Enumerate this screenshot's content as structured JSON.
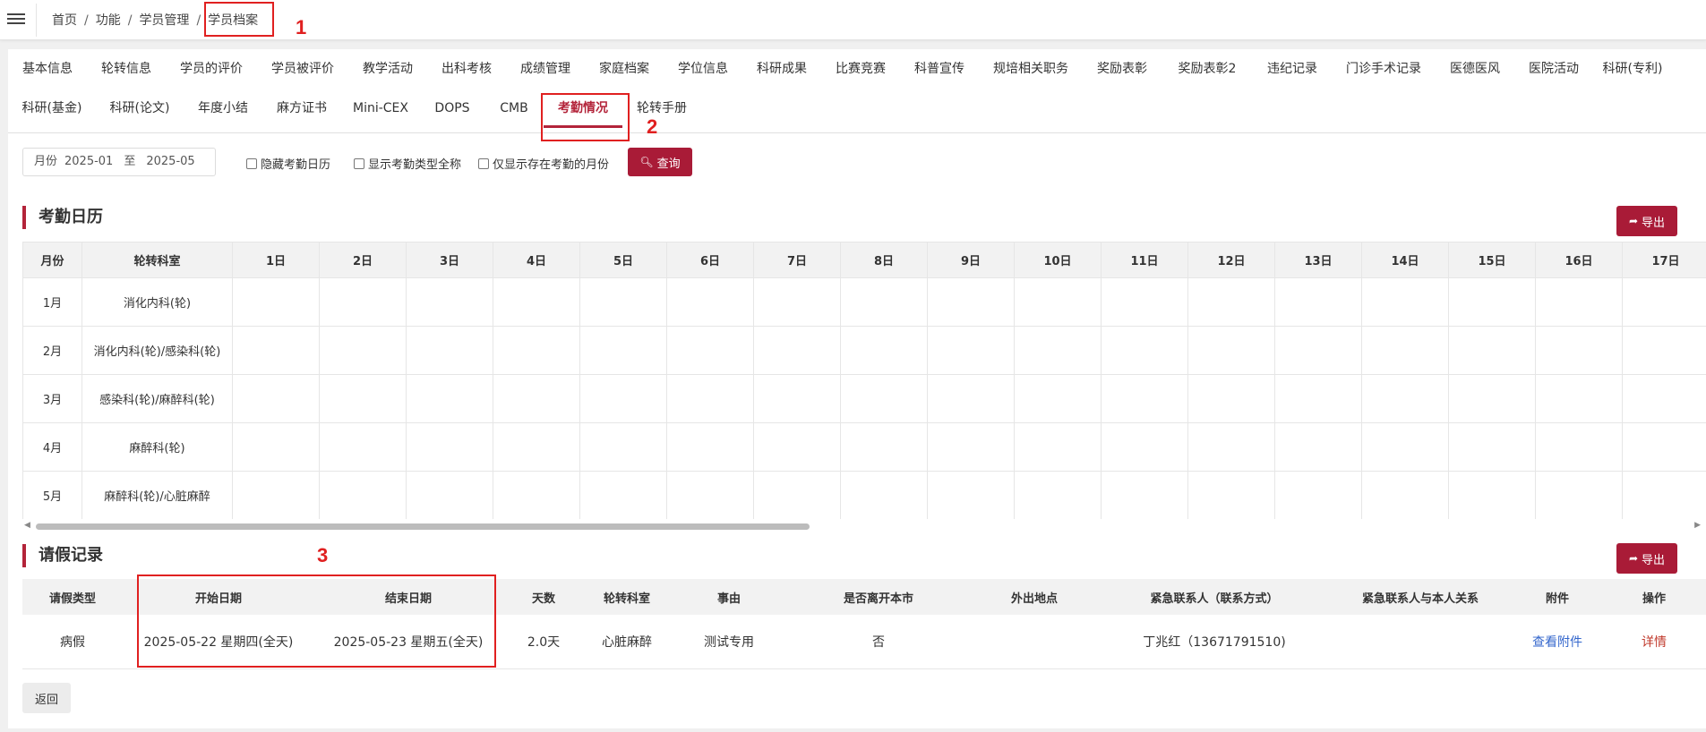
{
  "breadcrumb": {
    "items": [
      "首页",
      "功能",
      "学员管理",
      "学员档案"
    ],
    "separator": "/"
  },
  "tabs": {
    "row1": [
      "基本信息",
      "轮转信息",
      "学员的评价",
      "学员被评价",
      "教学活动",
      "出科考核",
      "成绩管理",
      "家庭档案",
      "学位信息",
      "科研成果",
      "比赛竞赛",
      "科普宣传",
      "规培相关职务",
      "奖励表彰",
      "奖励表彰2",
      "违纪记录",
      "门诊手术记录",
      "医德医风",
      "医院活动",
      "科研(专利)"
    ],
    "row2": [
      "科研(基金)",
      "科研(论文)",
      "年度小结",
      "麻方证书",
      "Mini-CEX",
      "DOPS",
      "CMB",
      "考勤情况",
      "轮转手册"
    ],
    "active": "考勤情况"
  },
  "annotations": [
    "1",
    "2",
    "3"
  ],
  "filter": {
    "month_label": "月份",
    "start_month": "2025-01",
    "to_label": "至",
    "end_month": "2025-05",
    "checkbox_hide_calendar": "隐藏考勤日历",
    "checkbox_show_fullname": "显示考勤类型全称",
    "checkbox_only_attendance": "仅显示存在考勤的月份",
    "query_button": "查询"
  },
  "attendance": {
    "title": "考勤日历",
    "export_button": "导出",
    "headers": [
      "月份",
      "轮转科室",
      "1日",
      "2日",
      "3日",
      "4日",
      "5日",
      "6日",
      "7日",
      "8日",
      "9日",
      "10日",
      "11日",
      "12日",
      "13日",
      "14日",
      "15日",
      "16日",
      "17日"
    ],
    "rows": [
      {
        "month": "1月",
        "dept": "消化内科(轮)"
      },
      {
        "month": "2月",
        "dept": "消化内科(轮)/感染科(轮)"
      },
      {
        "month": "3月",
        "dept": "感染科(轮)/麻醉科(轮)"
      },
      {
        "month": "4月",
        "dept": "麻醉科(轮)"
      },
      {
        "month": "5月",
        "dept": "麻醉科(轮)/心脏麻醉"
      }
    ]
  },
  "leave": {
    "title": "请假记录",
    "export_button": "导出",
    "headers": [
      "请假类型",
      "开始日期",
      "结束日期",
      "天数",
      "轮转科室",
      "事由",
      "是否离开本市",
      "外出地点",
      "紧急联系人（联系方式）",
      "紧急联系人与本人关系",
      "附件",
      "操作"
    ],
    "rows": [
      {
        "type": "病假",
        "start": "2025-05-22 星期四(全天)",
        "end": "2025-05-23 星期五(全天)",
        "days": "2.0天",
        "dept": "心脏麻醉",
        "reason": "测试专用",
        "leave_city": "否",
        "location": "",
        "contact": "丁兆红（13671791510)",
        "relation": "",
        "attachment": "查看附件",
        "action": "详情"
      }
    ]
  },
  "back_button": "返回",
  "colors": {
    "accent": "#b3243a",
    "annotation": "#e02020",
    "link": "#3366cc"
  }
}
